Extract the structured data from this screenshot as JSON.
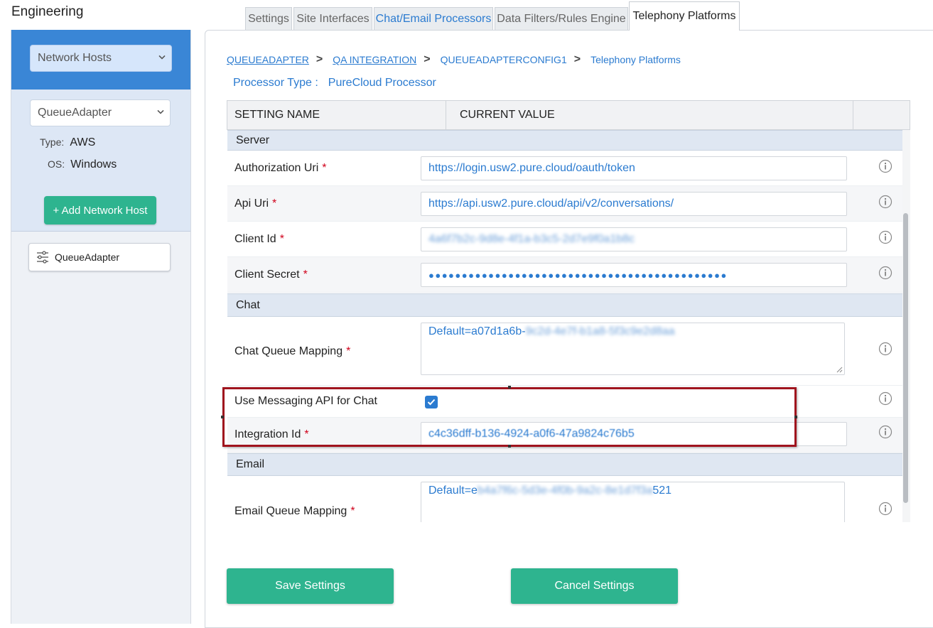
{
  "app": {
    "title": "Engineering"
  },
  "sidebar": {
    "host_type_select": {
      "value": "Network Hosts"
    },
    "host_select": {
      "value": "QueueAdapter"
    },
    "type_label": "Type:",
    "type_value": "AWS",
    "os_label": "OS:",
    "os_value": "Windows",
    "add_button_label": "+ Add Network Host",
    "host_card_label": "QueueAdapter"
  },
  "tabs": [
    {
      "label": "Settings"
    },
    {
      "label": "Site Interfaces"
    },
    {
      "label": "Chat/Email Processors"
    },
    {
      "label": "Data Filters/Rules Engine"
    },
    {
      "label": "Telephony Platforms"
    }
  ],
  "breadcrumb": [
    {
      "label": "QUEUEADAPTER"
    },
    {
      "label": "QA INTEGRATION"
    },
    {
      "label": "QUEUEADAPTERCONFIG1"
    },
    {
      "label": "Telephony Platforms"
    }
  ],
  "processor": {
    "label": "Processor Type :",
    "value": "PureCloud Processor"
  },
  "table": {
    "col_setting": "SETTING NAME",
    "col_value": "CURRENT VALUE",
    "sections": {
      "server": "Server",
      "chat": "Chat",
      "email": "Email"
    },
    "rows": {
      "auth_uri": {
        "label": "Authorization Uri",
        "value": "https://login.usw2.pure.cloud/oauth/token"
      },
      "api_uri": {
        "label": "Api Uri",
        "value": "https://api.usw2.pure.cloud/api/v2/conversations/"
      },
      "client_id": {
        "label": "Client Id",
        "value": "4a6f7b2c-9d8e-4f1a-b3c5-2d7e9f0a1b8c"
      },
      "client_secret": {
        "label": "Client Secret",
        "value": "●●●●●●●●●●●●●●●●●●●●●●●●●●●●●●●●●●●●●●●●●●●●●"
      },
      "chat_queue": {
        "label": "Chat Queue Mapping",
        "value_prefix": "Default=a07d1a6b-",
        "value_hidden": "9c2d-4e7f-b1a8-5f3c9e2d8aa"
      },
      "use_messaging": {
        "label": "Use Messaging API for Chat",
        "checked": true
      },
      "integration_id": {
        "label": "Integration Id",
        "value": "c4c36dff-b136-4924-a0f6-47a9824c76b5"
      },
      "email_queue": {
        "label": "Email Queue Mapping",
        "value_prefix": "Default=e",
        "value_hidden": "b4a7f6c-5d3e-4f0b-9a2c-8e1d7f3a",
        "value_suffix": "521"
      }
    },
    "required_mark": "*"
  },
  "actions": {
    "save_label": "Save Settings",
    "cancel_label": "Cancel Settings"
  },
  "colors": {
    "accent": "#2b7bd0",
    "button": "#2eb48f",
    "highlight": "#a0141e",
    "sidebar_header": "#3a86d6"
  }
}
